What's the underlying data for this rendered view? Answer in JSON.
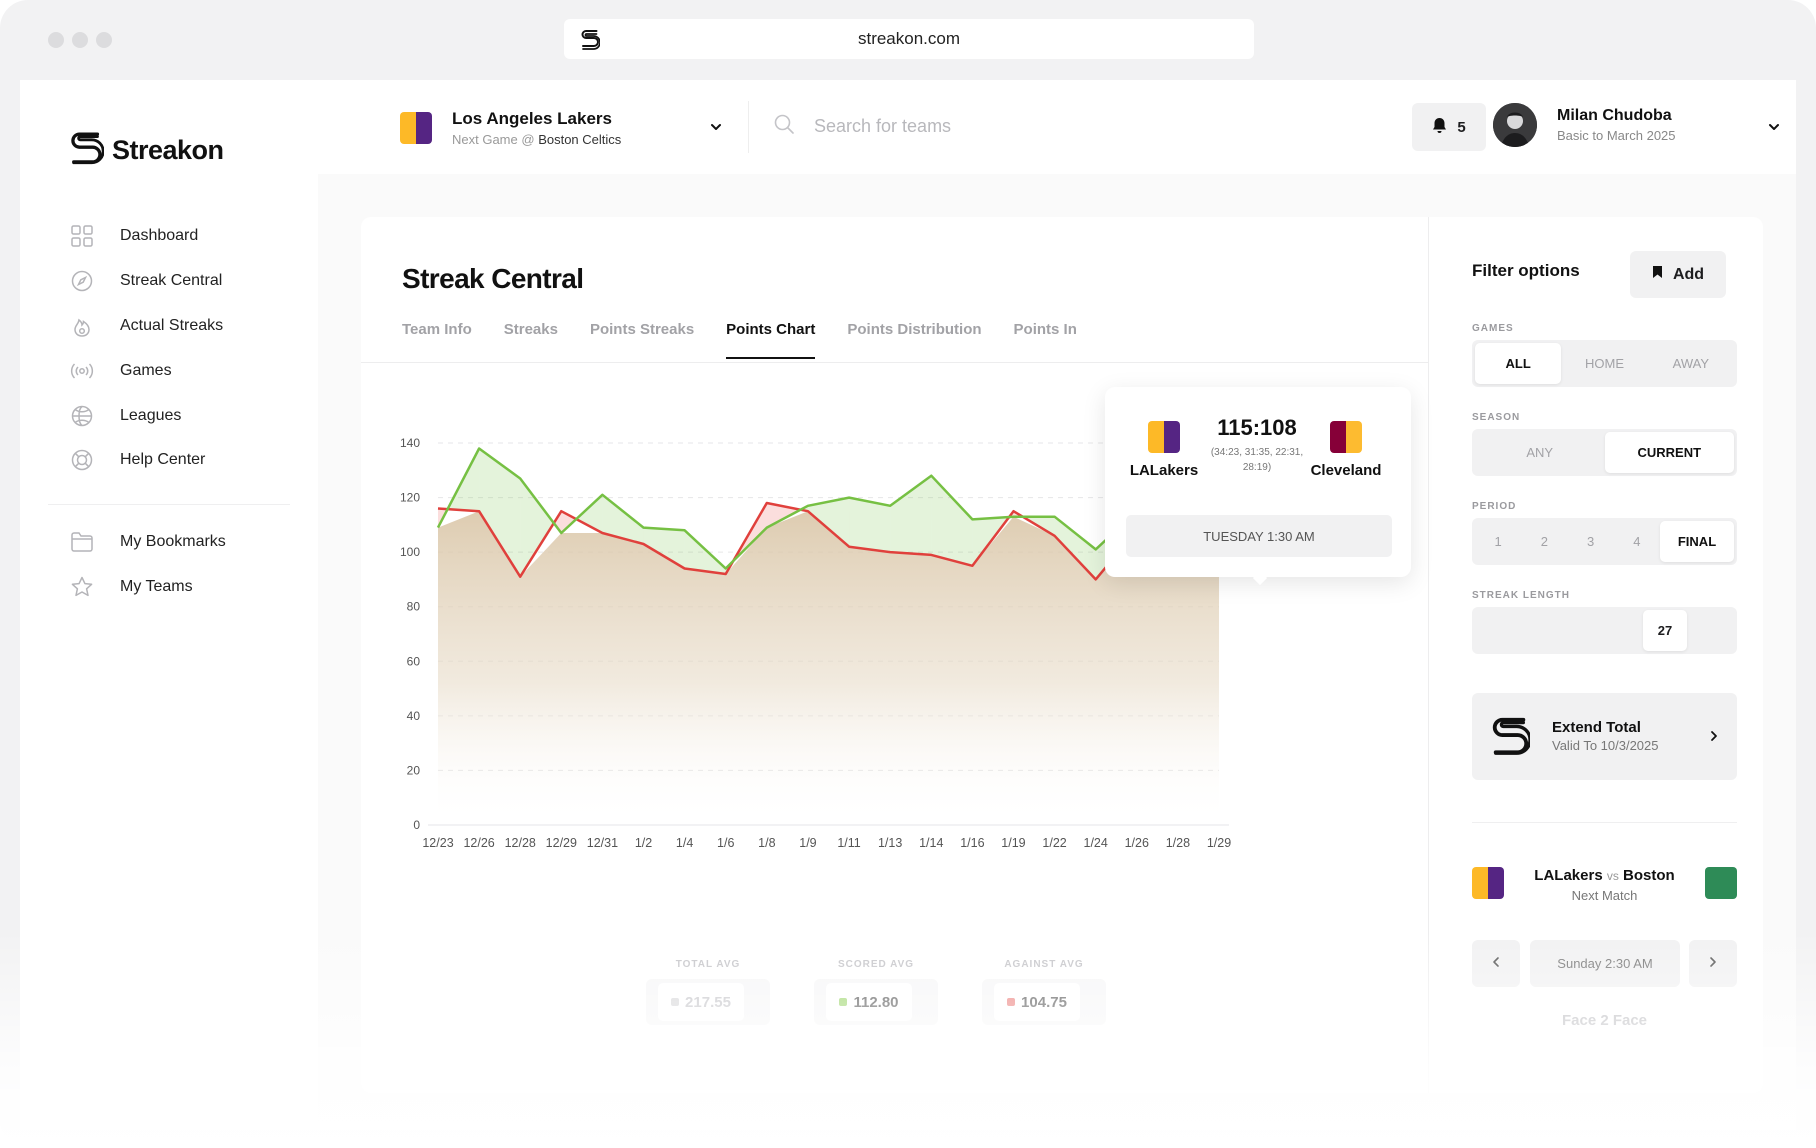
{
  "browser": {
    "url": "streakon.com"
  },
  "brand": {
    "name": "Streakon"
  },
  "sidebar": {
    "items": [
      {
        "label": "Dashboard",
        "icon": "grid-icon"
      },
      {
        "label": "Streak Central",
        "icon": "compass-icon"
      },
      {
        "label": "Actual Streaks",
        "icon": "flame-icon"
      },
      {
        "label": "Games",
        "icon": "broadcast-icon"
      },
      {
        "label": "Leagues",
        "icon": "ball-icon"
      },
      {
        "label": "Help Center",
        "icon": "lifebuoy-icon"
      }
    ],
    "secondary": [
      {
        "label": "My Bookmarks",
        "icon": "folder-icon"
      },
      {
        "label": "My Teams",
        "icon": "star-icon"
      }
    ]
  },
  "header": {
    "team": {
      "name": "Los Angeles Lakers",
      "next_prefix": "Next Game @",
      "next_opponent": "Boston Celtics"
    },
    "search_placeholder": "Search for teams",
    "notifications": "5",
    "user": {
      "name": "Milan Chudoba",
      "plan": "Basic to March 2025"
    }
  },
  "main": {
    "title": "Streak Central",
    "tabs": [
      "Team Info",
      "Streaks",
      "Points Streaks",
      "Points Chart",
      "Points Distribution",
      "Points In"
    ],
    "active_tab": "Points Chart"
  },
  "tooltip": {
    "home": "LALakers",
    "away": "Cleveland",
    "score": "115:108",
    "quarters": "(34:23, 31:35, 22:31, 28:19)",
    "time": "TUESDAY 1:30 AM"
  },
  "chart_data": {
    "type": "line",
    "x": [
      "12/23",
      "12/26",
      "12/28",
      "12/29",
      "12/31",
      "1/2",
      "1/4",
      "1/6",
      "1/8",
      "1/9",
      "1/11",
      "1/13",
      "1/14",
      "1/16",
      "1/19",
      "1/22",
      "1/24",
      "1/26",
      "1/28",
      "1/29"
    ],
    "y_ticks": [
      0,
      20,
      40,
      60,
      80,
      100,
      120,
      140
    ],
    "ylim": [
      0,
      140
    ],
    "grid": true,
    "series": [
      {
        "color": "#76c043",
        "values": [
          109,
          138,
          127,
          107,
          121,
          109,
          108,
          94,
          109,
          117,
          120,
          117,
          128,
          112,
          113,
          113,
          101,
          115,
          107,
          92
        ]
      },
      {
        "color": "#e0403c",
        "values": [
          116,
          115,
          91,
          115,
          107,
          103,
          94,
          92,
          118,
          115,
          102,
          100,
          99,
          95,
          115,
          106,
          90,
          108,
          107,
          107
        ]
      }
    ],
    "highlight_index": 17
  },
  "stats": [
    {
      "label": "TOTAL AVG",
      "value": "217.55",
      "color": "#d6d6d8",
      "value_color": "#c4c4c8"
    },
    {
      "label": "SCORED AVG",
      "value": "112.80",
      "color": "#9bd46a",
      "value_color": "#555"
    },
    {
      "label": "AGAINST AVG",
      "value": "104.75",
      "color": "#ec7f7c",
      "value_color": "#555"
    }
  ],
  "filters": {
    "title": "Filter options",
    "add_label": "Add",
    "games": {
      "label": "GAMES",
      "options": [
        "ALL",
        "HOME",
        "AWAY"
      ],
      "selected": "ALL"
    },
    "season": {
      "label": "SEASON",
      "options": [
        "ANY",
        "CURRENT"
      ],
      "selected": "CURRENT"
    },
    "period": {
      "label": "PERIOD",
      "options": [
        "1",
        "2",
        "3",
        "4",
        "FINAL"
      ],
      "selected": "FINAL"
    },
    "streak_length": {
      "label": "STREAK LENGTH",
      "value": "27"
    },
    "extend": {
      "title": "Extend Total",
      "sub": "Valid To 10/3/2025"
    },
    "match": {
      "home": "LALakers",
      "vs": "vs",
      "away": "Boston",
      "sub": "Next Match",
      "time": "Sunday 2:30 AM"
    },
    "face2face": "Face 2 Face"
  },
  "colors": {
    "lakers_gold": "#fdb927",
    "lakers_purple": "#552583",
    "cavs_wine": "#860038",
    "cavs_gold": "#fdbb30",
    "celtics_green": "#2e8b57",
    "scored": "#76c043",
    "against": "#e0403c"
  }
}
